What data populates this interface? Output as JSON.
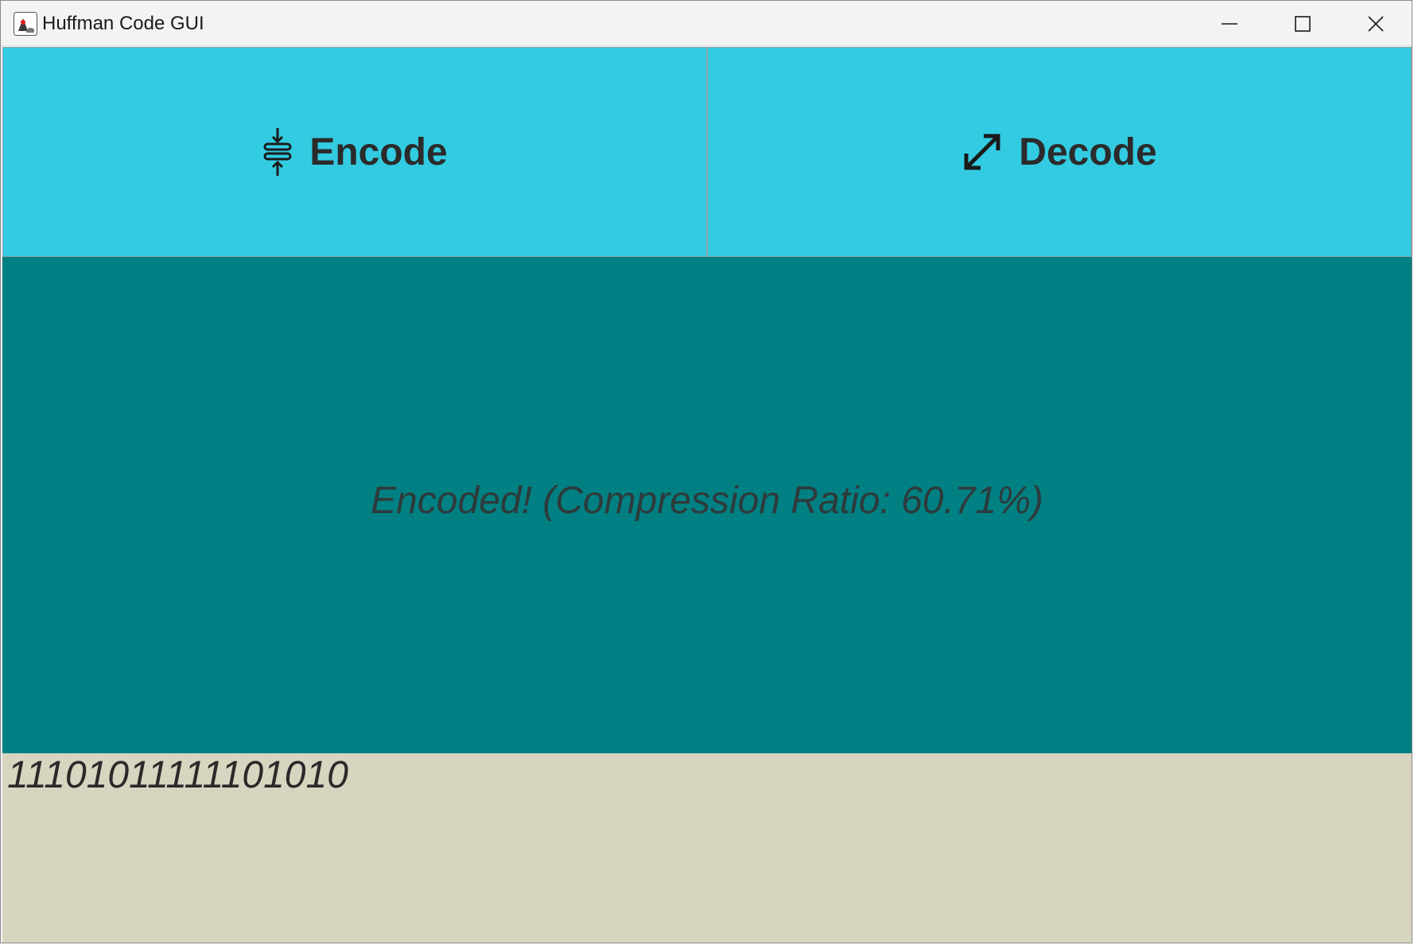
{
  "window": {
    "title": "Huffman Code GUI"
  },
  "icons": {
    "app": "java-duke-icon",
    "minimize": "minimize-icon",
    "maximize": "maximize-icon",
    "close": "close-icon",
    "encode": "compress-icon",
    "decode": "expand-icon"
  },
  "buttons": {
    "encode_label": "Encode",
    "decode_label": "Decode"
  },
  "status": {
    "message": "Encoded! (Compression Ratio: 60.71%)"
  },
  "output": {
    "value": "11101011111101010"
  },
  "colors": {
    "button_bg": "#33cbe1",
    "status_bg": "#008082",
    "output_bg": "#d7d5c0"
  }
}
